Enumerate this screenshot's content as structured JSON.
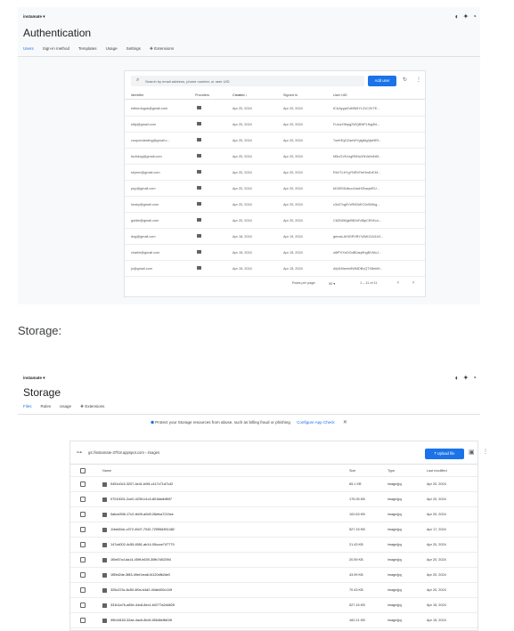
{
  "auth": {
    "project": "instamate ▾",
    "title": "Authentication",
    "tabs": [
      "Users",
      "Sign-in method",
      "Templates",
      "Usage",
      "Settings",
      "Extensions"
    ],
    "active_tab": "Users",
    "search_placeholder": "Search by email address, phone number, or user UID",
    "add_user_label": "Add user",
    "columns": [
      "Identifier",
      "Providers",
      "Created ↓",
      "Signed In",
      "User UID"
    ],
    "users": [
      {
        "identifier": "editordogue@gmail.com",
        "created": "Apr 20, 2024",
        "signed_in": "Apr 20, 2024",
        "uid": "tCAAyyytCdMN5YL31C2hTE..."
      },
      {
        "identifier": "kitty@gmail.com",
        "created": "Apr 20, 2024",
        "signed_in": "Apr 20, 2024",
        "uid": "Fu1wX5hpg2WQBNPLfhg3hi..."
      },
      {
        "identifier": "coupondealing@gmail.c...",
        "created": "Apr 20, 2024",
        "signed_in": "Apr 20, 2024",
        "uid": "7oeKEyD2aeWYgfgNg4jwNRf..."
      },
      {
        "identifier": "tochdog@gmail.com",
        "created": "Apr 20, 2024",
        "signed_in": "Apr 20, 2024",
        "uid": "M5uGVKJzgR0NuXNVa0nN6f..."
      },
      {
        "identifier": "shyrnn@gmail.com",
        "created": "Apr 20, 2024",
        "signed_in": "Apr 20, 2024",
        "uid": "RhV7LfrYgYNRhTieHmt1rEbf..."
      },
      {
        "identifier": "pup@gmail.com",
        "created": "Apr 20, 2024",
        "signed_in": "Apr 20, 2024",
        "uid": "bD05SDdkuo1kwHZbsqvfEU..."
      },
      {
        "identifier": "husky@gmail.com",
        "created": "Apr 20, 2024",
        "signed_in": "Apr 20, 2024",
        "uid": "c3x07vg5YvR0DkEC0dS0Ikg..."
      },
      {
        "identifier": "goldie@gmail.com",
        "created": "Apr 20, 2024",
        "signed_in": "Apr 20, 2024",
        "uid": "C6ZN0t0gbBBXrfVt8pCEhEco..."
      },
      {
        "identifier": "dog@gmail.com",
        "created": "Apr 18, 2024",
        "signed_in": "Apr 19, 2024",
        "uid": "gemaLAHlGRVBYVAW12A3Jr2..."
      },
      {
        "identifier": "charlie@gmail.com",
        "created": "Apr 15, 2024",
        "signed_in": "Apr 15, 2024",
        "uid": "o6fPVXnDGdB0aqHhgBVMoJ..."
      },
      {
        "identifier": "jc@gmail.com",
        "created": "Apr 15, 2024",
        "signed_in": "Apr 15, 2024",
        "uid": "Afpi1Meem8WMDBvQTX8ekt9..."
      }
    ],
    "rows_per_page_label": "Rows per page:",
    "rows_per_page_value": "50 ▾",
    "range": "1 – 11 of 11"
  },
  "storage_label": "Storage:",
  "storage": {
    "project": "instamate ▾",
    "title": "Storage",
    "tabs": [
      "Files",
      "Rules",
      "Usage",
      "Extensions"
    ],
    "active_tab": "Files",
    "banner_text": "Protect your Storage resources from abuse, such as billing fraud or phishing",
    "banner_link": "Configure App Check",
    "bucket_path": "gs://instamate-37fc8.appspot.com  ›  images",
    "upload_label": "Upload file",
    "columns": [
      "Name",
      "Size",
      "Type",
      "Last modified"
    ],
    "files": [
      {
        "name": "0451c0c3-3207-4e41-b0f4-c117c71d7c42",
        "size": "65.1 KB",
        "type": "image/jpg",
        "modified": "Apr 20, 2024"
      },
      {
        "name": "07010001-2ce0-4239-b1c3-8016ddbff4f7",
        "size": "175.05 KB",
        "type": "image/jpg",
        "modified": "Apr 20, 2024"
      },
      {
        "name": "0abcd396-17c2-4b09-a0d9-26efca7219ce",
        "size": "102.63 KB",
        "type": "image/jpg",
        "modified": "Apr 20, 2024"
      },
      {
        "name": "11bd40dc-c372-40d7-7042-72955d351482",
        "size": "527.15 KB",
        "type": "image/jpg",
        "modified": "Apr 17, 2024"
      },
      {
        "name": "147cd002-4c55-4581-ab14-05ccce747779",
        "size": "21.43 KB",
        "type": "image/jpg",
        "modified": "Apr 20, 2024"
      },
      {
        "name": "1f0e87cd-da14-459f-b639-30ffc7d52094",
        "size": "20.59 KB",
        "type": "image/jpg",
        "modified": "Apr 20, 2024"
      },
      {
        "name": "1f59d2de-3f83-49ef-bea6-f4120dfb2de0",
        "size": "43.99 KB",
        "type": "image/jpg",
        "modified": "Apr 20, 2024"
      },
      {
        "name": "325c223c-8c50-4f0a-b4d2-40de400c119f",
        "size": "70.43 KB",
        "type": "image/jpg",
        "modified": "Apr 20, 2024"
      },
      {
        "name": "331b1a7b-a65e-44c8-8ec1-b0277a2c6825",
        "size": "527.15 KB",
        "type": "image/jpg",
        "modified": "Apr 15, 2024"
      },
      {
        "name": "39b18163-32ae-4ac6-8b4f-155d8ef6619f",
        "size": "162.21 KB",
        "type": "image/jpg",
        "modified": "Apr 15, 2024"
      }
    ]
  }
}
